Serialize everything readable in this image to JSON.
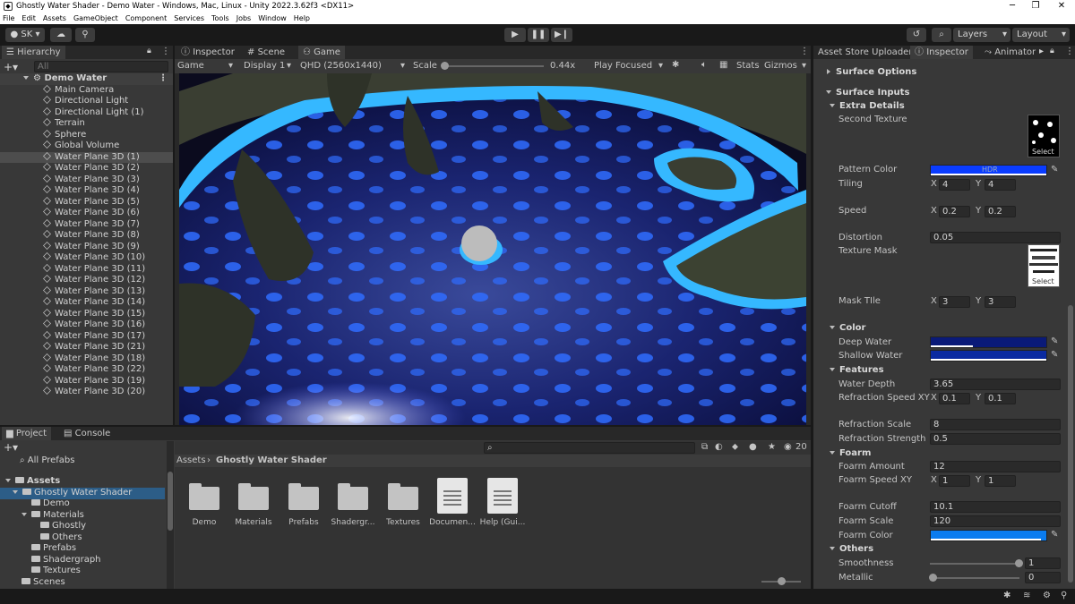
{
  "window": {
    "title": "Ghostly Water Shader - Demo Water - Windows, Mac, Linux - Unity 2022.3.62f3 <DX11>"
  },
  "menu": [
    "File",
    "Edit",
    "Assets",
    "GameObject",
    "Component",
    "Services",
    "Tools",
    "Jobs",
    "Window",
    "Help"
  ],
  "toolbar": {
    "account": "SK",
    "layers": "Layers",
    "layout": "Layout"
  },
  "hierarchy": {
    "tab": "Hierarchy",
    "search_placeholder": "All",
    "scene": "Demo Water",
    "items": [
      "Main Camera",
      "Directional Light",
      "Directional Light (1)",
      "Terrain",
      "Sphere",
      "Global Volume",
      "Water Plane 3D (1)",
      "Water Plane 3D (2)",
      "Water Plane 3D (3)",
      "Water Plane 3D (4)",
      "Water Plane 3D (5)",
      "Water Plane 3D (6)",
      "Water Plane 3D (7)",
      "Water Plane 3D (8)",
      "Water Plane 3D (9)",
      "Water Plane 3D (10)",
      "Water Plane 3D (11)",
      "Water Plane 3D (12)",
      "Water Plane 3D (13)",
      "Water Plane 3D (14)",
      "Water Plane 3D (15)",
      "Water Plane 3D (16)",
      "Water Plane 3D (17)",
      "Water Plane 3D (21)",
      "Water Plane 3D (18)",
      "Water Plane 3D (22)",
      "Water Plane 3D (19)",
      "Water Plane 3D (20)"
    ]
  },
  "center_tabs": [
    "Inspector",
    "Scene",
    "Game"
  ],
  "game_bar": {
    "view": "Game",
    "display": "Display 1",
    "resolution": "QHD (2560x1440)",
    "scale_label": "Scale",
    "scale_value": "0.44x",
    "play_mode": "Play Focused",
    "stats": "Stats",
    "gizmos": "Gizmos"
  },
  "project": {
    "tabs": [
      "Project",
      "Console"
    ],
    "favorites": "All Prefabs",
    "breadcrumb": [
      "Assets",
      "Ghostly Water Shader"
    ],
    "count": "20",
    "tree": [
      "Assets",
      "Ghostly Water Shader",
      "Demo",
      "Materials",
      "Ghostly",
      "Others",
      "Prefabs",
      "Shadergraph",
      "Textures",
      "Scenes"
    ],
    "files": [
      "Demo",
      "Materials",
      "Prefabs",
      "Shadergr...",
      "Textures",
      "Documen...",
      "Help (Gui..."
    ]
  },
  "right_tabs": [
    "Asset Store Uploader",
    "Inspector",
    "Animator"
  ],
  "inspector": {
    "surface_options": "Surface Options",
    "surface_inputs": "Surface Inputs",
    "extra_details": "Extra Details",
    "second_texture": "Second Texture",
    "select": "Select",
    "pattern_color": "Pattern Color",
    "hdr": "HDR",
    "tiling": "Tiling",
    "tiling_x": "4",
    "tiling_y": "4",
    "speed": "Speed",
    "speed_x": "0.2",
    "speed_y": "0.2",
    "distortion": "Distortion",
    "distortion_value": "0.05",
    "texture_mask": "Texture Mask",
    "mask_tile": "Mask TIle",
    "mask_x": "3",
    "mask_y": "3",
    "color_section": "Color",
    "deep_water": "Deep Water",
    "shallow_water": "Shallow Water",
    "features": "Features",
    "water_depth": "Water Depth",
    "water_depth_value": "3.65",
    "refraction_speed": "Refraction Speed XY",
    "refraction_x": "0.1",
    "refraction_y": "0.1",
    "refraction_scale": "Refraction Scale",
    "refraction_scale_value": "8",
    "refraction_strength": "Refraction Strength",
    "refraction_strength_value": "0.5",
    "foarm": "Foarm",
    "foarm_amount": "Foarm Amount",
    "foarm_amount_value": "12",
    "foarm_speed": "Foarm Speed XY",
    "foarm_x": "1",
    "foarm_y": "1",
    "foarm_cutoff": "Foarm Cutoff",
    "foarm_cutoff_value": "10.1",
    "foarm_scale": "Foarm Scale",
    "foarm_scale_value": "120",
    "foarm_color": "Foarm Color",
    "others": "Others",
    "smoothness": "Smoothness",
    "smoothness_value": "1",
    "metallic": "Metallic",
    "metallic_value": "0",
    "x": "X",
    "y": "Y"
  },
  "colors": {
    "pattern": "#0a3cff",
    "deep": "#0a1a78",
    "shallow": "#0a2aa0",
    "foarm": "#0a7cf0",
    "selection": "#2c5d87"
  }
}
